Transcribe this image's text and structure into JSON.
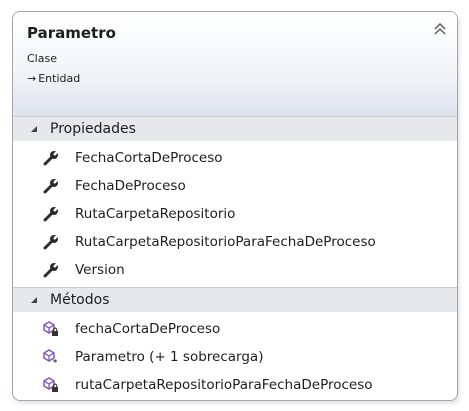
{
  "class": {
    "name": "Parametro",
    "kind": "Clase",
    "base": "Entidad"
  },
  "sections": {
    "properties": {
      "label": "Propiedades",
      "items": [
        {
          "name": "FechaCortaDeProceso",
          "icon": "wrench-property-icon"
        },
        {
          "name": "FechaDeProceso",
          "icon": "wrench-property-icon"
        },
        {
          "name": "RutaCarpetaRepositorio",
          "icon": "wrench-property-icon"
        },
        {
          "name": "RutaCarpetaRepositorioParaFechaDeProceso",
          "icon": "wrench-property-icon"
        },
        {
          "name": "Version",
          "icon": "wrench-property-icon"
        }
      ]
    },
    "methods": {
      "label": "Métodos",
      "items": [
        {
          "name": "fechaCortaDeProceso",
          "icon": "private-method-icon"
        },
        {
          "name": "Parametro (+ 1 sobrecarga)",
          "icon": "constructor-method-icon"
        },
        {
          "name": "rutaCarpetaRepositorioParaFechaDeProceso",
          "icon": "private-method-icon"
        }
      ]
    }
  },
  "colors": {
    "method_purple": "#7b4fc4",
    "wrench": "#2b2b2b",
    "border": "#9fa6b4",
    "section_bg": "#e6e8ec"
  }
}
